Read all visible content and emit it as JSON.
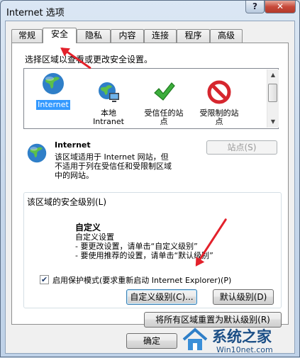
{
  "window": {
    "title": "Internet 选项",
    "help": "?",
    "close": "✕"
  },
  "tabs": [
    {
      "label": "常规"
    },
    {
      "label": "安全"
    },
    {
      "label": "隐私"
    },
    {
      "label": "内容"
    },
    {
      "label": "连接"
    },
    {
      "label": "程序"
    },
    {
      "label": "高级"
    }
  ],
  "active_tab": "安全",
  "zone_prompt": "选择区域以查看或更改安全设置。",
  "zones": [
    {
      "label": "Internet",
      "icon": "globe-icon"
    },
    {
      "label": "本地\nIntranet",
      "icon": "intranet-icon"
    },
    {
      "label": "受信任的站\n点",
      "icon": "check-icon"
    },
    {
      "label": "受限制的站\n点",
      "icon": "prohibited-icon"
    }
  ],
  "zone_info": {
    "name": "Internet",
    "description": "该区域适用于 Internet 网站，但\n不适用于列在受信任和受限制区域\n中的网站。",
    "sites_button": "站点(S)"
  },
  "security_level": {
    "group_label": "该区域的安全级别(L)",
    "level_name": "自定义",
    "details": "自定义设置\n- 要更改设置，请单击“自定义级别”\n- 要使用推荐的设置，请单击“默认级别”"
  },
  "protected_mode": {
    "label": "启用保护模式(要求重新启动 Internet Explorer)(P)",
    "checked": true
  },
  "buttons": {
    "custom_level": "自定义级别(C)...",
    "default_level": "默认级别(D)",
    "reset_all": "将所有区域重置为默认级别(R)",
    "ok": "确定"
  },
  "watermark": {
    "brand": "系统之家",
    "url": "Win10net.com"
  },
  "colors": {
    "selection": "#3399ff",
    "annotation_arrow": "#e3212b"
  }
}
